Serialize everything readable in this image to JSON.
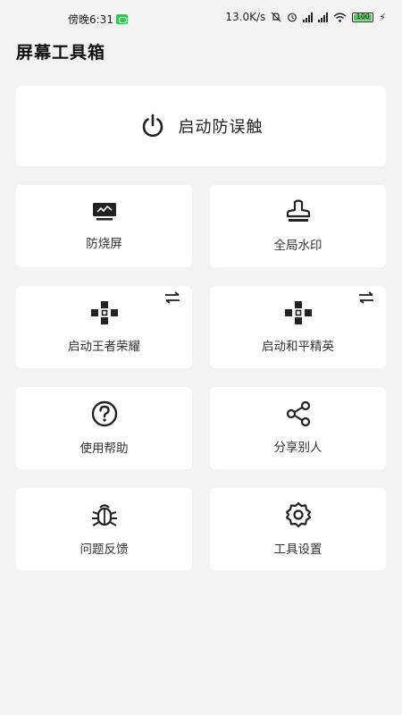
{
  "status_bar": {
    "time": "傍晚6:31",
    "speed": "13.0K/s",
    "battery": "100"
  },
  "app": {
    "title": "屏幕工具箱"
  },
  "main_action": {
    "label": "启动防误触",
    "icon": "power-icon"
  },
  "tiles": [
    {
      "label": "防烧屏",
      "icon": "monitor-icon"
    },
    {
      "label": "全局水印",
      "icon": "stamp-icon"
    },
    {
      "label": "启动王者荣耀",
      "icon": "gamepad-icon",
      "badge_icon": "swap-icon"
    },
    {
      "label": "启动和平精英",
      "icon": "gamepad-icon",
      "badge_icon": "swap-icon"
    },
    {
      "label": "使用帮助",
      "icon": "help-icon"
    },
    {
      "label": "分享别人",
      "icon": "share-icon"
    },
    {
      "label": "问题反馈",
      "icon": "bug-icon"
    },
    {
      "label": "工具设置",
      "icon": "gear-icon"
    }
  ]
}
